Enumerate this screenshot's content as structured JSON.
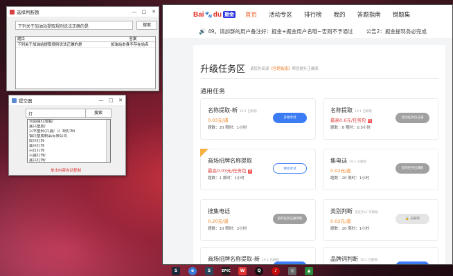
{
  "win1": {
    "title": "选择判断题",
    "question": "下列关于加油站提取规则说法正确的是",
    "search_label": "搜索",
    "columns": [
      "题目",
      "答案"
    ],
    "rows": [
      [
        "下列关于加油站提取规则说法正确的是",
        "加油站本身不存在站名"
      ]
    ]
  },
  "win2": {
    "title": "提交器",
    "input": "灯",
    "search_label": "搜索",
    "list": [
      "河南路灯加盐厂",
      "鑫兴塑胶厂",
      "兴丰塑料(兴鑫厂)厂制灯饰厂",
      "镇兴塑胶制品有限公司",
      "民兴灯饰",
      "鑫兴灯饰",
      "兴灯灯饰",
      "兴鑫灯饰厂",
      "鑫兴灯饰厂"
    ],
    "footer": "单击内容自动复制"
  },
  "browser": {
    "logo_text": "Bai",
    "logo_du": "du",
    "logo_badge": "掘金",
    "nav": [
      "首页",
      "活动专区",
      "排行榜",
      "我的",
      "答题指南",
      "错题集"
    ],
    "notice1": "49。请加群的用户备注好：掘金+掘金用户名哦~否则不予通过",
    "notice2": "公告2：掘金提现务必完成",
    "title": "升级任务区",
    "subtitle_pre": "请您先阅读",
    "subtitle_link": "《答题指南》",
    "subtitle_post": "帮您提升正确率",
    "section": "通用任务",
    "cards": [
      {
        "name": "名称提取-新",
        "meta": "19.1 已解锁",
        "price": "0.03元/道",
        "info": "题数：20  限时：1小时",
        "btn": "开始考试",
        "style": "blue",
        "red": false,
        "hot": false,
        "ribbon": false
      },
      {
        "name": "名称提取",
        "meta": "19.1 已解锁",
        "price": "最高0.6元/任务包",
        "info": "题数：8  限时：0.5小时",
        "btn": "您的任务包已满",
        "style": "grey",
        "red": true,
        "hot": true,
        "ribbon": false
      },
      {
        "name": "商场招牌名称提取",
        "meta": "",
        "price": "最高0.03元/任务包",
        "info": "题数：1  限时：1小时",
        "btn": "继续考试",
        "style": "outline",
        "red": true,
        "hot": true,
        "ribbon": true
      },
      {
        "name": "集电话",
        "meta": "19.1 已解锁",
        "price": "0.02元/道",
        "info": "题数：20  限时：1小时",
        "btn": "您的任务已满啦",
        "style": "grey",
        "red": false,
        "hot": false,
        "ribbon": false
      },
      {
        "name": "搜集电话",
        "meta": "",
        "price": "0.20元/道",
        "info": "题数：10  限时：2小时",
        "btn": "您的任务已被领取",
        "style": "grey",
        "red": false,
        "hot": false,
        "ribbon": false
      },
      {
        "name": "类别判断",
        "meta": "该任务L1 可解锁",
        "price": "0.02元/道",
        "info": "题数：20  限时：1小时",
        "btn": "🔒 未解锁",
        "style": "light",
        "red": false,
        "hot": false,
        "ribbon": false
      },
      {
        "name": "商场招牌名称提取-新",
        "meta": "19.1 已解锁",
        "price": "0.03元/道",
        "info": "",
        "btn": "开始考试",
        "style": "blue",
        "red": false,
        "hot": false,
        "ribbon": false
      },
      {
        "name": "品牌词判断",
        "meta": "19.1 已解锁",
        "price": "0.07元/道",
        "info": "",
        "btn": "开始考试",
        "style": "blue",
        "red": false,
        "hot": false,
        "ribbon": false
      }
    ]
  },
  "taskbar": [
    "steam",
    "browser",
    "steam2",
    "EPIC",
    "wps",
    "qq",
    "music",
    "app",
    "game"
  ]
}
